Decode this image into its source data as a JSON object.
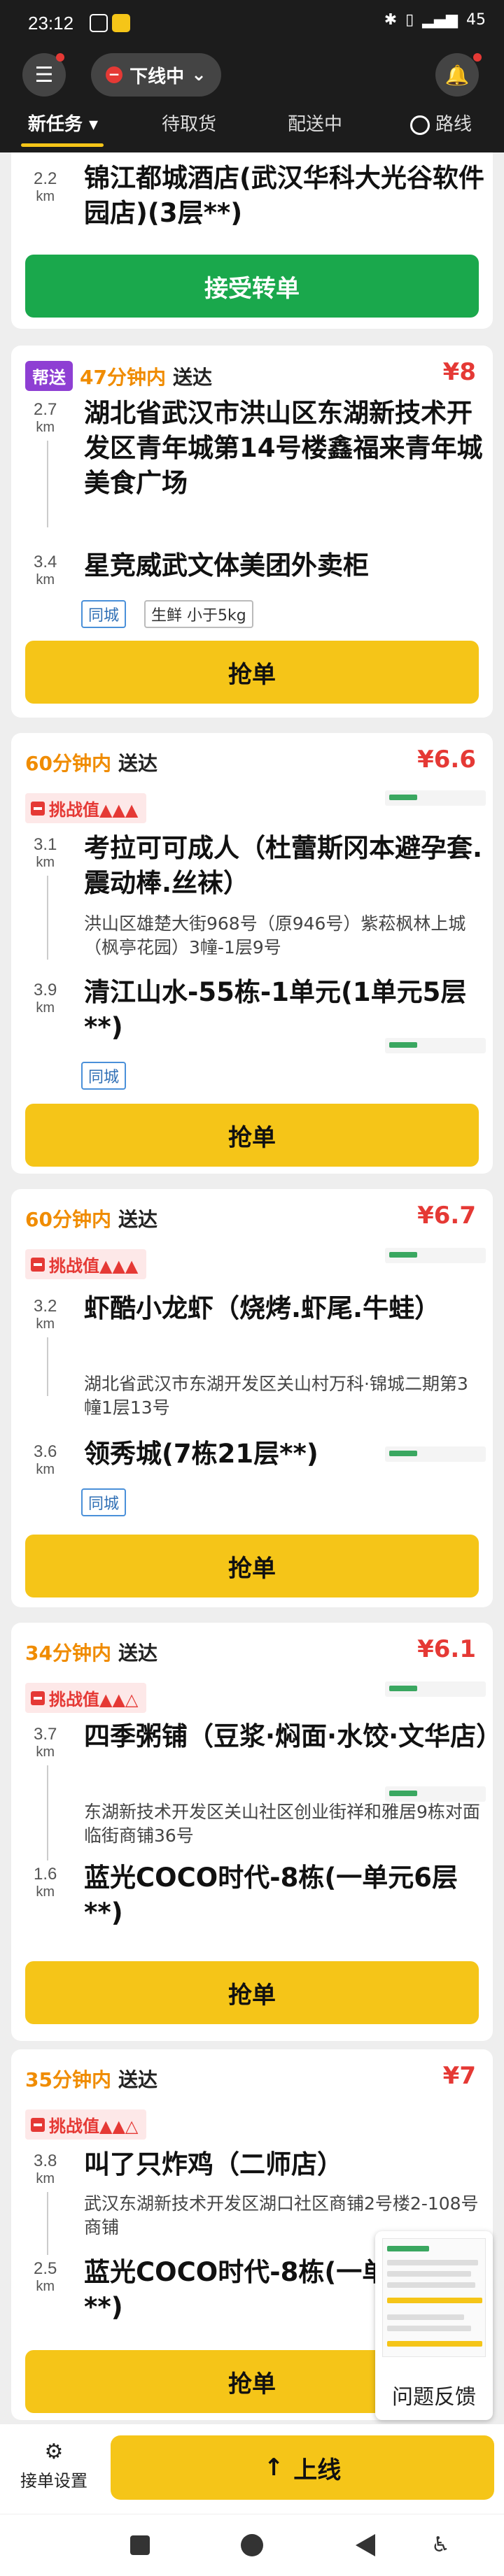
{
  "status_bar": {
    "time": "23:12",
    "battery": "45"
  },
  "header": {
    "offline_label": "下线中"
  },
  "tabs": [
    {
      "label": "新任务"
    },
    {
      "label": "待取货"
    },
    {
      "label": "配送中"
    },
    {
      "label": "路线"
    }
  ],
  "cards": [
    {
      "distance": "2.2",
      "unit": "km",
      "address": "锦江都城酒店(武汉华科大光谷软件园店)(3层**)",
      "button": "接受转单"
    },
    {
      "tag": "帮送",
      "time": "47分钟内",
      "deliver": "送达",
      "price": "¥8",
      "pickup_distance": "2.7",
      "pickup": "湖北省武汉市洪山区东湖新技术开发区青年城第14号楼鑫福来青年城美食广场",
      "dropoff_distance": "3.4",
      "dropoff": "星竞威武文体美团外卖柜",
      "pills": [
        "同城",
        "生鲜 小于5kg"
      ],
      "button": "抢单",
      "unit": "km"
    },
    {
      "time": "60分钟内",
      "deliver": "送达",
      "price": "¥6.6",
      "challenge": "挑战值▲▲▲",
      "pickup_distance": "3.1",
      "pickup": "考拉可可成人（杜蕾斯冈本避孕套.震动棒.丝袜）",
      "pickup_sub": "洪山区雄楚大街968号（原946号）紫菘枫林上城（枫亭花园）3幢-1层9号",
      "dropoff_distance": "3.9",
      "dropoff": "清江山水-55栋-1单元(1单元5层**)",
      "pills": [
        "同城"
      ],
      "button": "抢单",
      "unit": "km"
    },
    {
      "time": "60分钟内",
      "deliver": "送达",
      "price": "¥6.7",
      "challenge": "挑战值▲▲▲",
      "pickup_distance": "3.2",
      "pickup": "虾酷小龙虾（烧烤.虾尾.牛蛙）",
      "pickup_sub": "湖北省武汉市东湖开发区关山村万科·锦城二期第3幢1层13号",
      "dropoff_distance": "3.6",
      "dropoff": "领秀城(7栋21层**)",
      "pills": [
        "同城"
      ],
      "button": "抢单",
      "unit": "km"
    },
    {
      "time": "34分钟内",
      "deliver": "送达",
      "price": "¥6.1",
      "challenge": "挑战值▲▲△",
      "pickup_distance": "3.7",
      "pickup": "四季粥铺（豆浆·焖面·水饺·文华店）",
      "pickup_sub": "东湖新技术开发区关山社区创业街祥和雅居9栋对面临街商铺36号",
      "dropoff_distance": "1.6",
      "dropoff": "蓝光COCO时代-8栋(一单元6层**)",
      "button": "抢单",
      "unit": "km"
    },
    {
      "time": "35分钟内",
      "deliver": "送达",
      "price": "¥7",
      "challenge": "挑战值▲▲△",
      "pickup_distance": "3.8",
      "pickup": "叫了只炸鸡（二师店）",
      "pickup_sub": "武汉东湖新技术开发区湖口社区商铺2号楼2-108号商铺",
      "dropoff_distance": "2.5",
      "dropoff": "蓝光COCO时代-8栋(一单元6层**)",
      "button": "抢单",
      "unit": "km"
    }
  ],
  "feedback": {
    "label": "问题反馈"
  },
  "bottom": {
    "settings_label": "接单设置",
    "online_label": "上线"
  }
}
